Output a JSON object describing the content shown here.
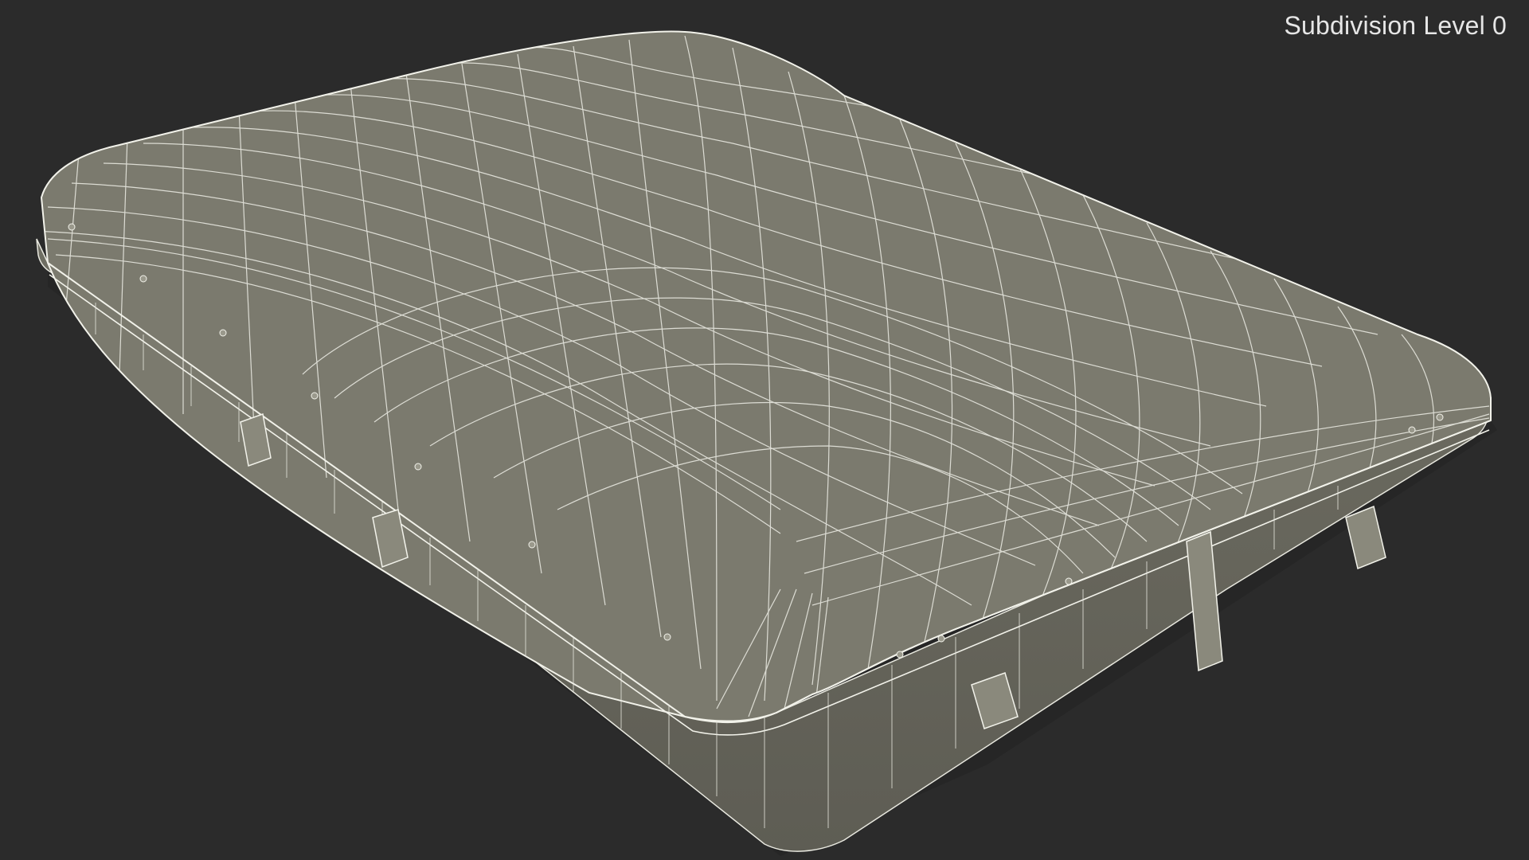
{
  "overlay": {
    "label": "Subdivision Level 0"
  },
  "scene": {
    "subject": "wireframe-case-model",
    "background_color": "#2b2b2b",
    "surface_color": "#7b7a6e",
    "wire_color": "#f2f2ea",
    "label_color": "#e6e6e6"
  }
}
